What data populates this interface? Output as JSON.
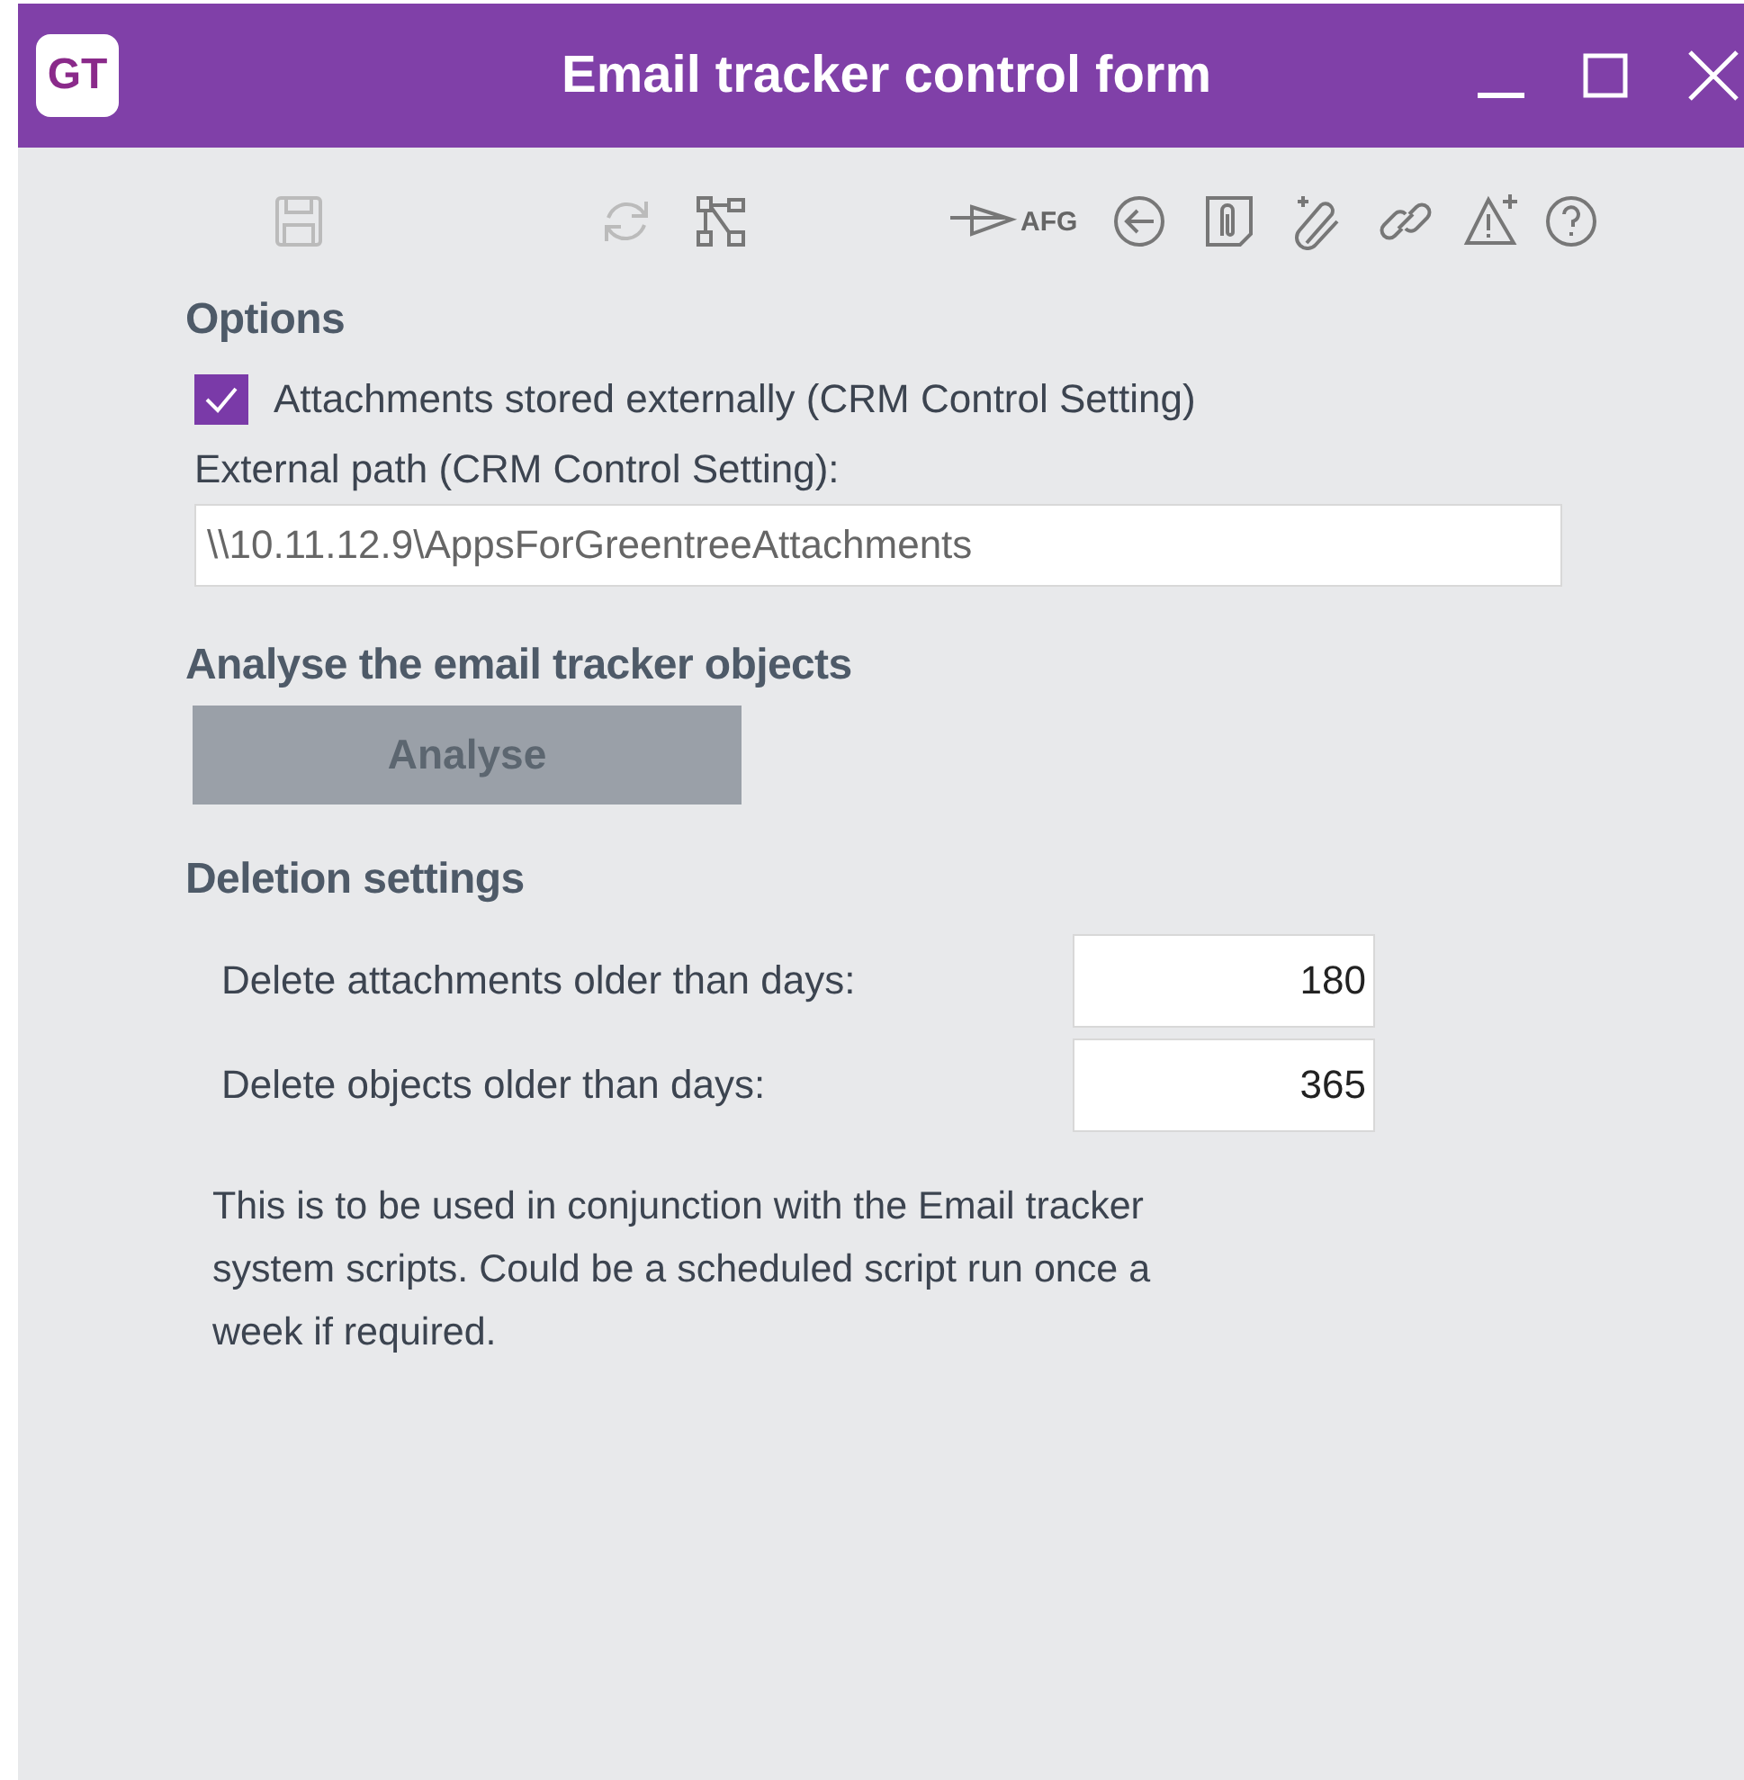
{
  "window": {
    "logo": "GT",
    "title": "Email tracker control form"
  },
  "toolbar": [
    {
      "kind": "save",
      "disabled": true
    },
    {
      "kind": "refresh",
      "disabled": true
    },
    {
      "kind": "network",
      "disabled": false
    },
    {
      "kind": "send",
      "label": "AFG",
      "disabled": false
    },
    {
      "kind": "back",
      "disabled": false
    },
    {
      "kind": "document-clip",
      "disabled": false
    },
    {
      "kind": "add-clip",
      "disabled": false
    },
    {
      "kind": "link",
      "disabled": false
    },
    {
      "kind": "warning-add",
      "disabled": false
    },
    {
      "kind": "help",
      "disabled": false
    }
  ],
  "options": {
    "heading": "Options",
    "checkbox": {
      "label": "Attachments stored externally (CRM Control Setting)",
      "checked": true
    },
    "path_label": "External path (CRM Control Setting):",
    "path_value": "\\\\10.11.12.9\\AppsForGreentreeAttachments"
  },
  "analyse": {
    "heading": "Analyse the email tracker objects",
    "button": "Analyse",
    "disabled": true
  },
  "deletion": {
    "heading": "Deletion settings",
    "rows": [
      {
        "label": "Delete attachments older than days:",
        "value": "180"
      },
      {
        "label": "Delete objects older than days:",
        "value": "365"
      }
    ],
    "note": "This is to be used in conjunction with the Email tracker system scripts. Could be a scheduled script run once a week if required."
  }
}
